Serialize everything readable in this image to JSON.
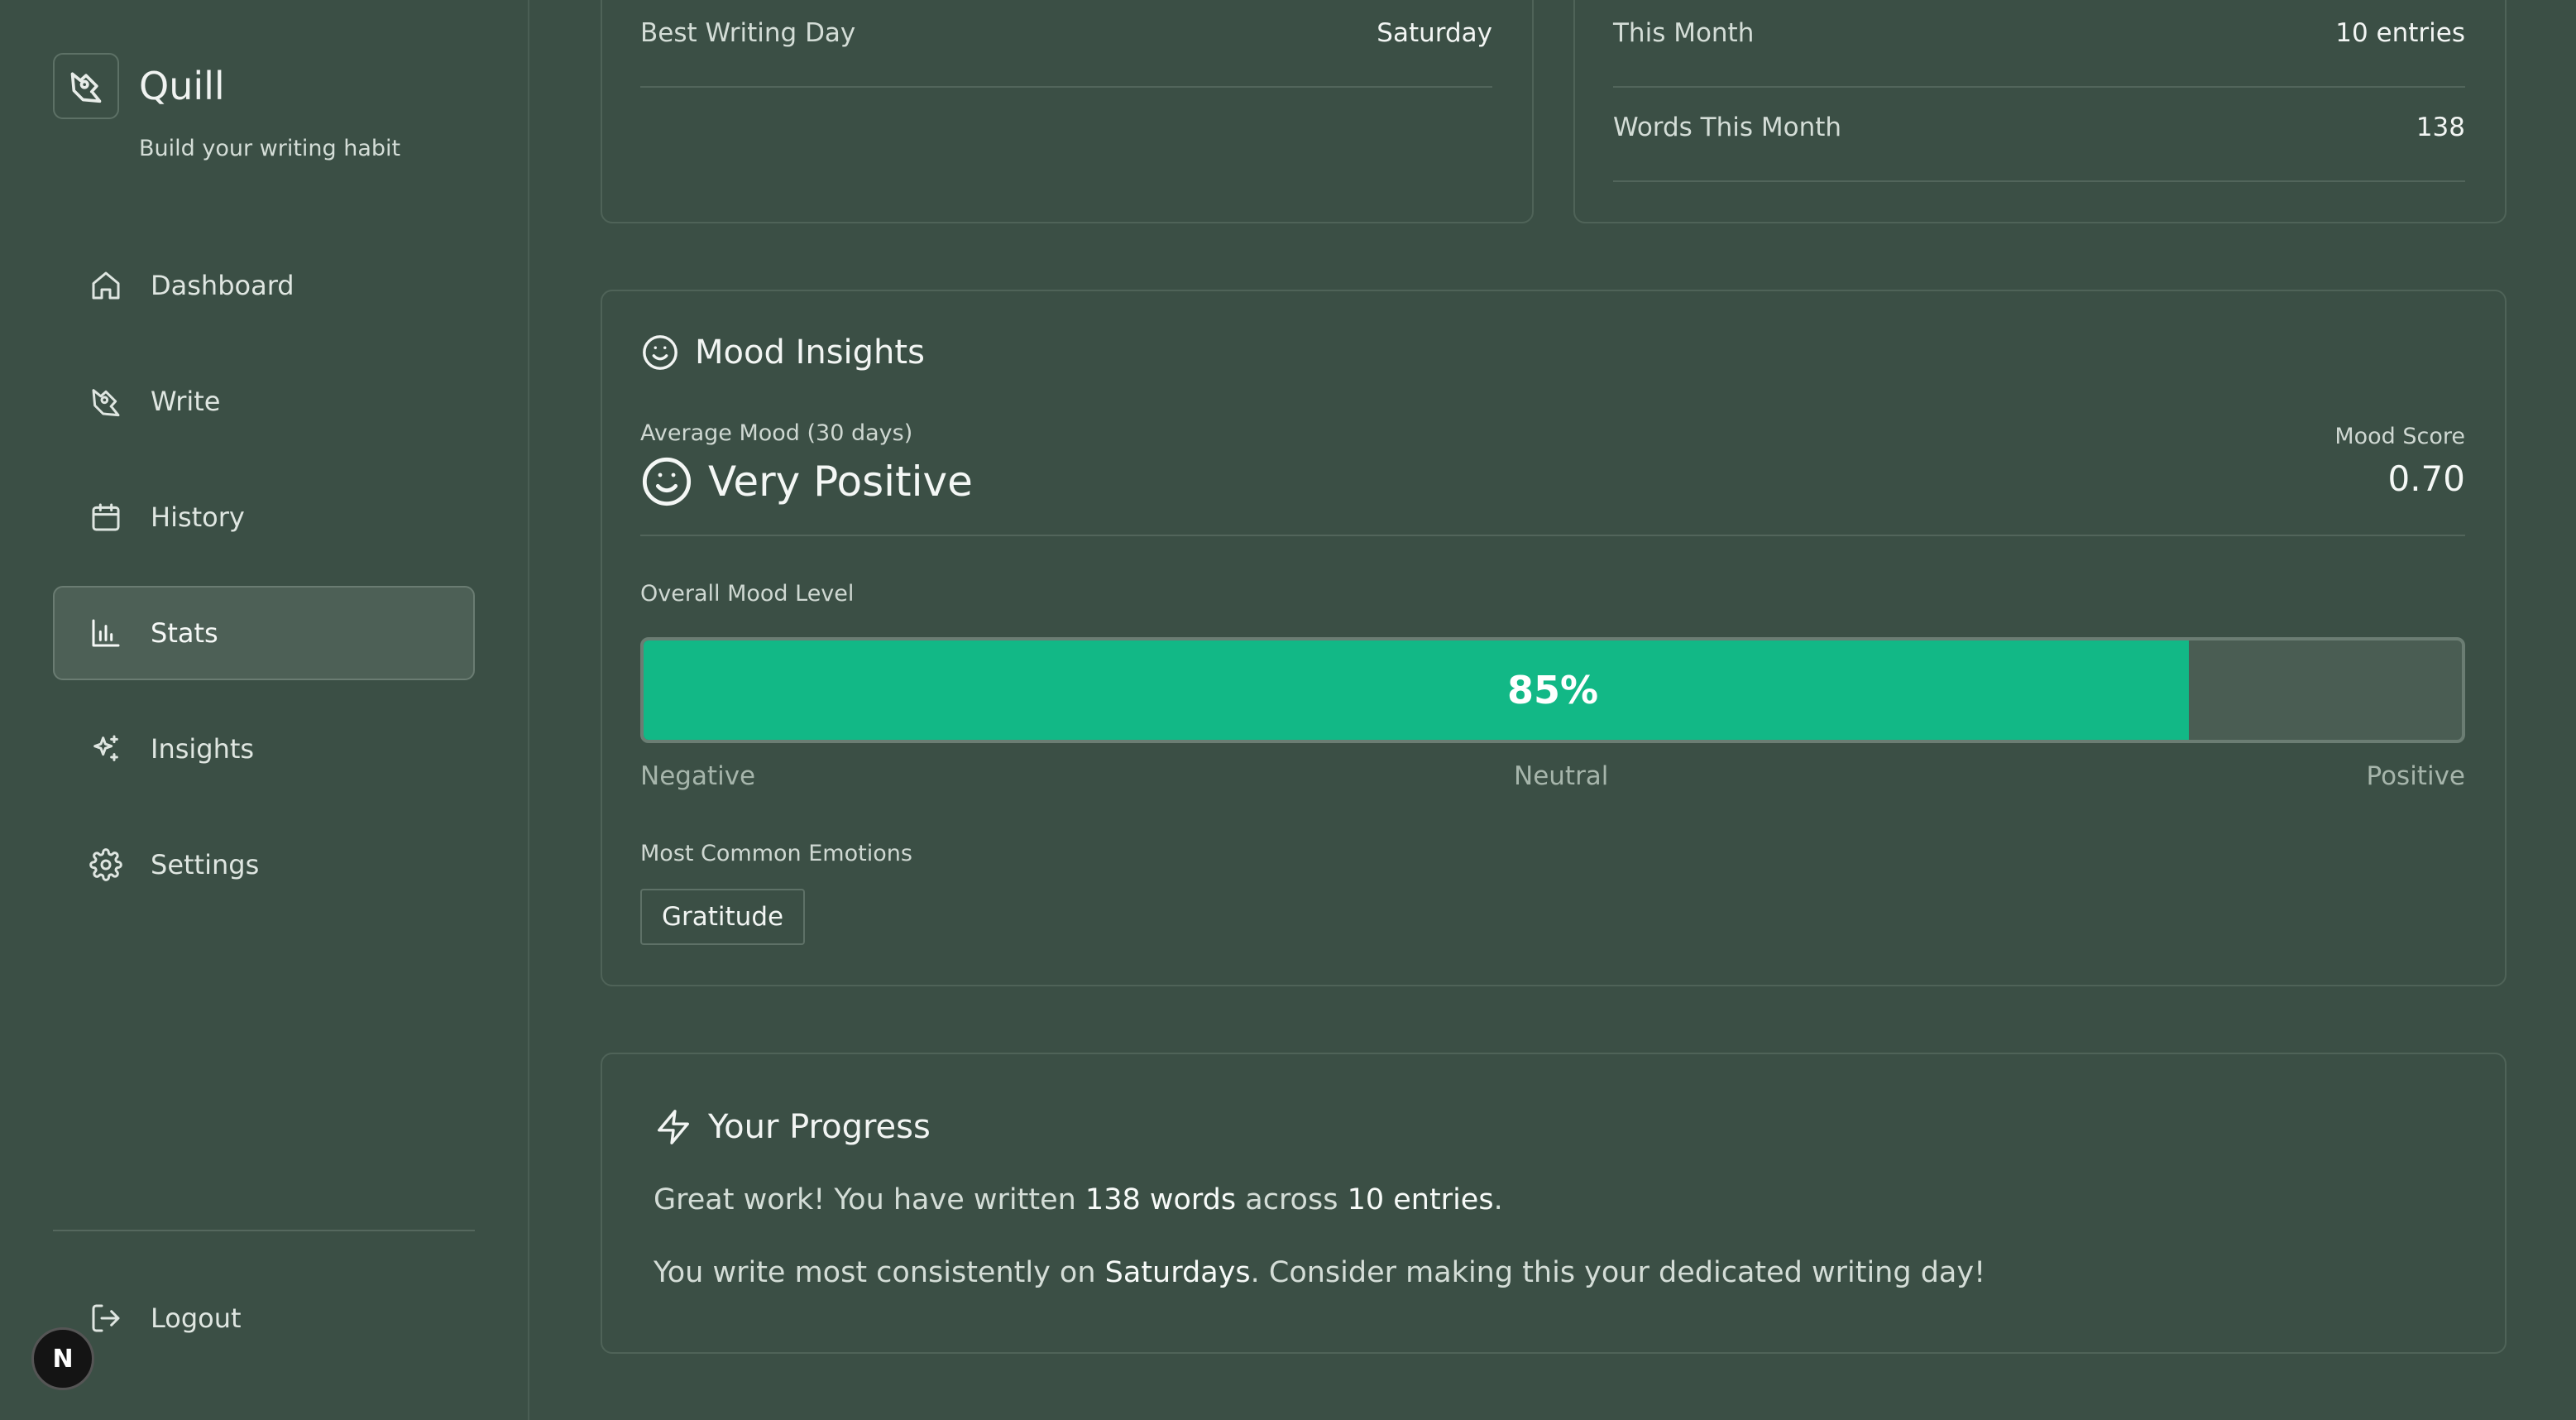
{
  "app": {
    "name": "Quill",
    "tagline": "Build your writing habit",
    "badge": "N"
  },
  "sidebar": {
    "items": [
      {
        "label": "Dashboard",
        "icon": "home-icon"
      },
      {
        "label": "Write",
        "icon": "pen-icon"
      },
      {
        "label": "History",
        "icon": "calendar-icon"
      },
      {
        "label": "Stats",
        "icon": "bar-chart-icon",
        "active": true
      },
      {
        "label": "Insights",
        "icon": "sparkles-icon"
      },
      {
        "label": "Settings",
        "icon": "gear-icon"
      }
    ],
    "logout_label": "Logout"
  },
  "stats_left": {
    "best_day_label": "Best Writing Day",
    "best_day_value": "Saturday"
  },
  "stats_right": {
    "this_month_label": "This Month",
    "this_month_value": "10 entries",
    "words_month_label": "Words This Month",
    "words_month_value": "138"
  },
  "mood": {
    "title": "Mood Insights",
    "avg_label": "Average Mood (30 days)",
    "avg_value": "Very Positive",
    "score_label": "Mood Score",
    "score_value": "0.70",
    "level_label": "Overall Mood Level",
    "level_percent": 85,
    "level_text": "85%",
    "scale": {
      "negative": "Negative",
      "neutral": "Neutral",
      "positive": "Positive"
    },
    "emotions_label": "Most Common Emotions",
    "emotions": [
      "Gratitude"
    ],
    "accent_color": "#12b886"
  },
  "progress": {
    "title": "Your Progress",
    "line1_a": "Great work! You have written ",
    "line1_words": "138 words",
    "line1_b": " across ",
    "line1_entries": "10 entries",
    "line1_c": ".",
    "line2_a": "You write most consistently on ",
    "line2_day": "Saturdays",
    "line2_b": ". Consider making this your dedicated writing day!"
  }
}
